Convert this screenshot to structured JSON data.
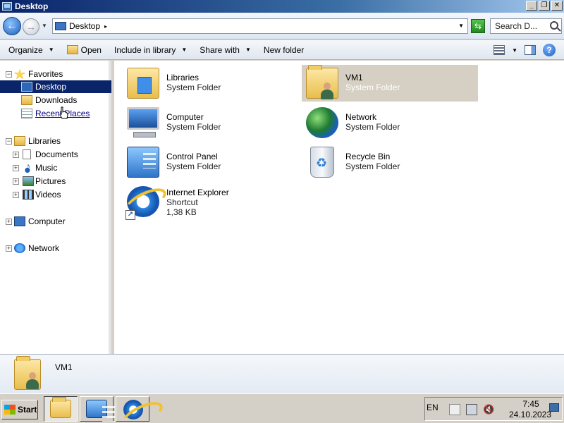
{
  "window": {
    "title": "Desktop",
    "controls": {
      "minimize": "_",
      "restore": "❐",
      "close": "✕"
    }
  },
  "address": {
    "location": "Desktop",
    "search_placeholder": "Search D..."
  },
  "commands": {
    "organize": "Organize",
    "open": "Open",
    "include_in_library": "Include in library",
    "share_with": "Share with",
    "new_folder": "New folder"
  },
  "nav": {
    "favorites": "Favorites",
    "desktop": "Desktop",
    "downloads": "Downloads",
    "recent_places": "Recent Places",
    "libraries": "Libraries",
    "documents": "Documents",
    "music": "Music",
    "pictures": "Pictures",
    "videos": "Videos",
    "computer": "Computer",
    "network": "Network",
    "expanded_symbol": "−",
    "collapsed_symbol": "+"
  },
  "items": [
    {
      "name": "Libraries",
      "type": "System Folder",
      "icon": "libraries-icon"
    },
    {
      "name": "VM1",
      "type": "System Folder",
      "icon": "user-folder-icon",
      "selected": true
    },
    {
      "name": "Computer",
      "type": "System Folder",
      "icon": "computer-icon"
    },
    {
      "name": "Network",
      "type": "System Folder",
      "icon": "network-icon"
    },
    {
      "name": "Control Panel",
      "type": "System Folder",
      "icon": "control-panel-icon"
    },
    {
      "name": "Recycle Bin",
      "type": "System Folder",
      "icon": "recycle-bin-icon"
    },
    {
      "name": "Internet Explorer",
      "type": "Shortcut",
      "size": "1,38 KB",
      "icon": "internet-explorer-icon"
    }
  ],
  "details": {
    "name": "VM1"
  },
  "taskbar": {
    "start": "Start",
    "language": "EN",
    "time": "7:45",
    "date": "24.10.2023"
  },
  "colors": {
    "selection": "#0a246a",
    "item_selected": "#d6d0c4",
    "title_gradient_start": "#0a246a"
  }
}
